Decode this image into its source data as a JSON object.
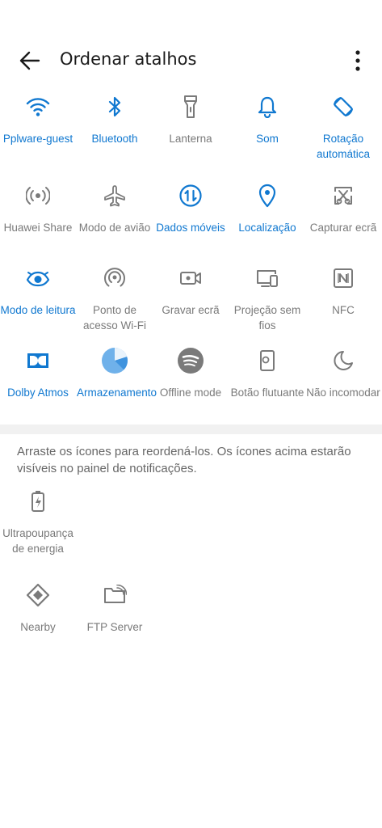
{
  "header": {
    "title": "Ordenar atalhos"
  },
  "active_color": "#1078d0",
  "inactive_color": "#7a7a7a",
  "enabled_tiles": [
    {
      "label": "Pplware-guest",
      "icon": "wifi-icon",
      "active": true
    },
    {
      "label": "Bluetooth",
      "icon": "bluetooth-icon",
      "active": true
    },
    {
      "label": "Lanterna",
      "icon": "flashlight-icon",
      "active": false
    },
    {
      "label": "Som",
      "icon": "bell-icon",
      "active": true
    },
    {
      "label": "Rotação automática",
      "icon": "auto-rotate-icon",
      "active": true
    },
    {
      "label": "Huawei Share",
      "icon": "huawei-share-icon",
      "active": false
    },
    {
      "label": "Modo de avião",
      "icon": "airplane-icon",
      "active": false
    },
    {
      "label": "Dados móveis",
      "icon": "mobile-data-icon",
      "active": true
    },
    {
      "label": "Localização",
      "icon": "location-pin-icon",
      "active": true
    },
    {
      "label": "Capturar ecrã",
      "icon": "screenshot-scissors-icon",
      "active": false
    },
    {
      "label": "Modo de leitura",
      "icon": "eye-icon",
      "active": true
    },
    {
      "label": "Ponto de acesso Wi-Fi",
      "icon": "hotspot-icon",
      "active": false
    },
    {
      "label": "Gravar ecrã",
      "icon": "screen-record-icon",
      "active": false
    },
    {
      "label": "Projeção sem fios",
      "icon": "wireless-projection-icon",
      "active": false
    },
    {
      "label": "NFC",
      "icon": "nfc-icon",
      "active": false
    },
    {
      "label": "Dolby Atmos",
      "icon": "dolby-icon",
      "active": true
    },
    {
      "label": "Armazenamento",
      "icon": "storage-pie-icon",
      "active": true
    },
    {
      "label": "Offline mode",
      "icon": "spotify-icon",
      "active": false
    },
    {
      "label": "Botão flutuante",
      "icon": "floating-button-icon",
      "active": false
    },
    {
      "label": "Não incomodar",
      "icon": "moon-icon",
      "active": false
    }
  ],
  "hint": "Arraste os ícones para reordená-los. Os ícones acima estarão visíveis no painel de notificações.",
  "available_tiles": [
    {
      "label": "Ultrapoupança de energia",
      "icon": "battery-saver-icon",
      "active": false
    },
    {
      "label": "Nearby",
      "icon": "nearby-icon",
      "active": false
    },
    {
      "label": "FTP Server",
      "icon": "ftp-folder-icon",
      "active": false
    }
  ]
}
